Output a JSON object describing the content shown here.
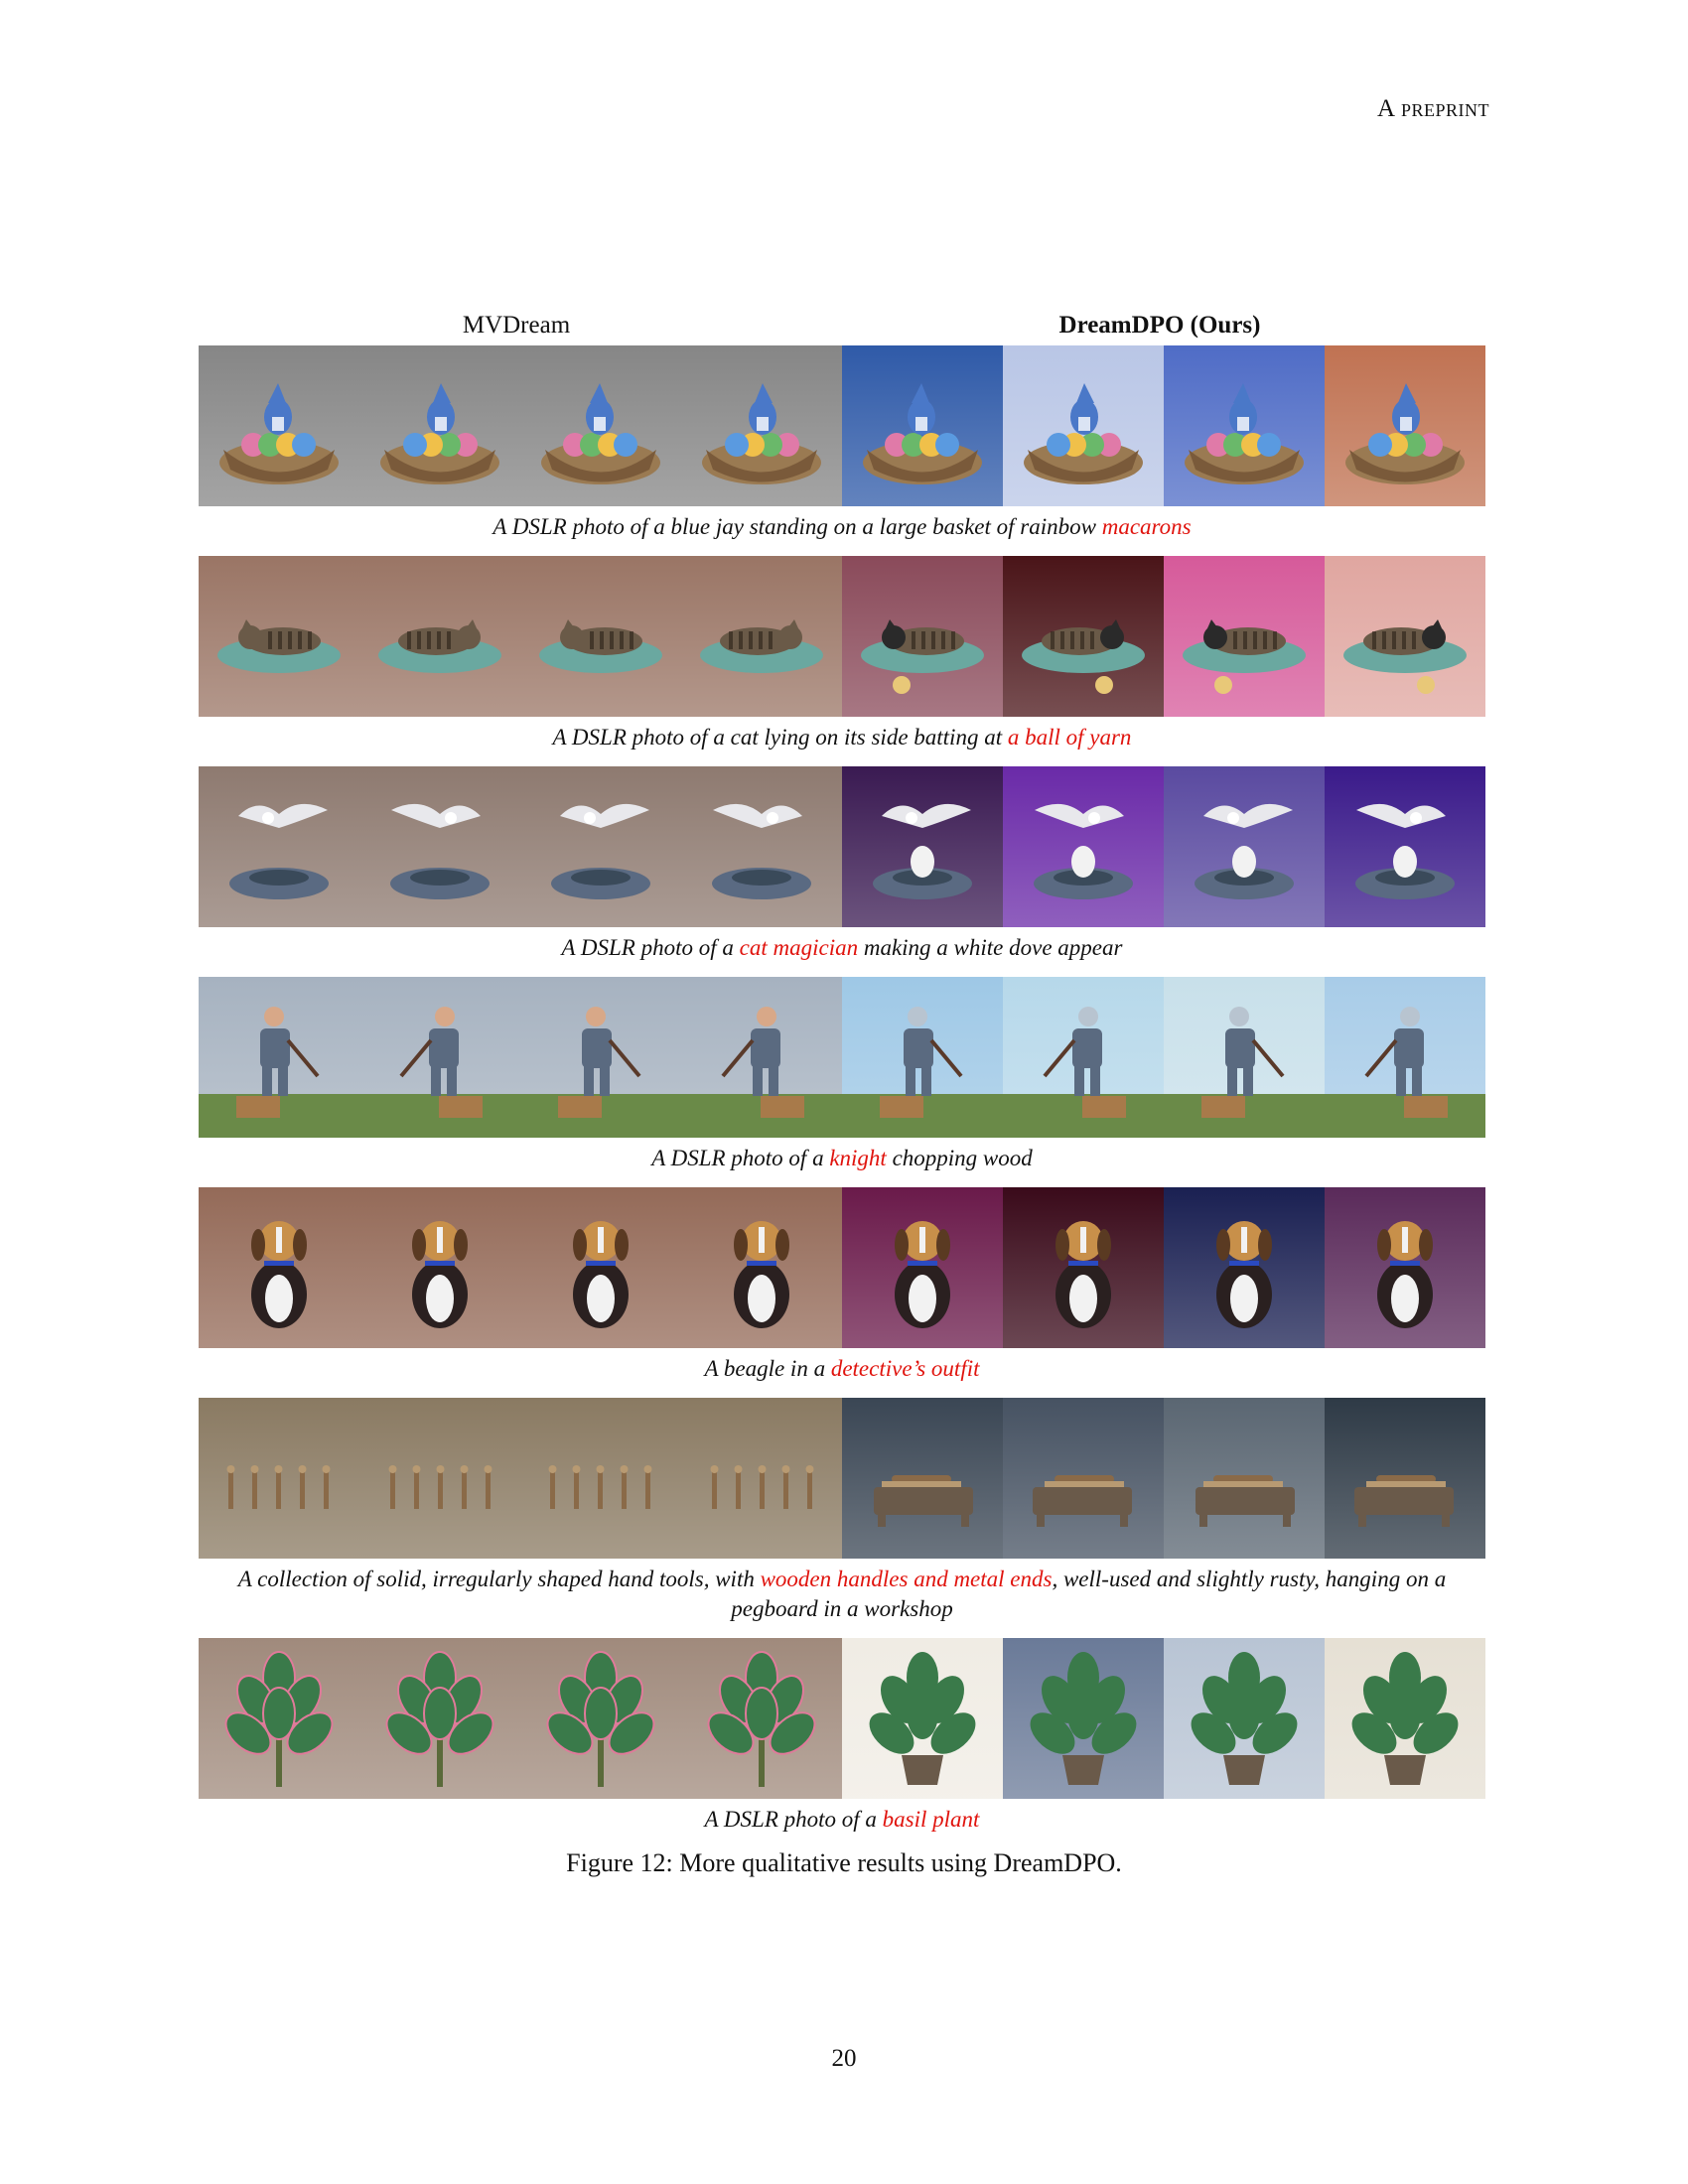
{
  "running_head": "A preprint",
  "columns": {
    "left": "MVDream",
    "right": "DreamDPO (Ours)"
  },
  "rows": [
    {
      "subject": "blue jay on macaron basket",
      "caption": {
        "pre": "A DSLR photo of a blue jay standing on a large basket of rainbow ",
        "hl": "macarons",
        "post": ""
      },
      "left_bg": "#868686",
      "right_bgs": [
        "#2f5aa8",
        "#b9c6e6",
        "#4f6cc6",
        "#c07252"
      ],
      "colors": {
        "main": "#4a78c8",
        "base": "#9a7a52",
        "accent": "#e07aa8"
      }
    },
    {
      "subject": "cat on yarn mat",
      "caption": {
        "pre": "A DSLR photo of a cat lying on its side batting at ",
        "hl": "a ball of yarn",
        "post": ""
      },
      "left_bg": "#9a7565",
      "right_bgs": [
        "#8a4a5a",
        "#4a1418",
        "#d65a9a",
        "#e0a6a0"
      ],
      "colors": {
        "main": "#6a5a48",
        "base": "#6aa8a0",
        "accent": "#e8c878"
      }
    },
    {
      "subject": "dove and cat magician",
      "caption": {
        "pre": "A DSLR photo of a ",
        "hl": "cat magician",
        "post": " making a white dove appear"
      },
      "left_bg": "#8e7a70",
      "right_bgs": [
        "#3a1a52",
        "#6a2aa8",
        "#5a4aa0",
        "#3a1a8a"
      ],
      "colors": {
        "main": "#e8e8ec",
        "base": "#5a6a82",
        "accent": "#c8a048"
      }
    },
    {
      "subject": "person chopping wood",
      "caption": {
        "pre": "A DSLR photo of a ",
        "hl": "knight",
        "post": " chopping wood"
      },
      "left_bg": "#a6b2c0",
      "right_bgs": [
        "#9ec8e6",
        "#b6d8ea",
        "#c8e0ea",
        "#a8cce8"
      ],
      "colors": {
        "main": "#5a6a80",
        "base": "#6a8a48",
        "accent": "#a87a4a"
      }
    },
    {
      "subject": "beagle",
      "caption": {
        "pre": "A beagle in a ",
        "hl": "detective’s outfit",
        "post": ""
      },
      "left_bg": "#946a58",
      "right_bgs": [
        "#6a1a4a",
        "#3a0a1a",
        "#1a2052",
        "#5a2a5a"
      ],
      "colors": {
        "main": "#c8904a",
        "base": "#f2f2f2",
        "accent": "#2a2020"
      }
    },
    {
      "subject": "hand tools",
      "caption": {
        "pre": "A collection of solid, irregularly shaped hand tools, with ",
        "hl": "wooden handles and metal ends",
        "post": ", well-used and slightly rusty, hanging on a pegboard in a workshop"
      },
      "left_bg": "#8a7a62",
      "right_bgs": [
        "#3a4654",
        "#465262",
        "#5a6672",
        "#2e3a46"
      ],
      "colors": {
        "main": "#8a6a48",
        "base": "#6a5a4a",
        "accent": "#b89a72"
      }
    },
    {
      "subject": "plant",
      "caption": {
        "pre": "A DSLR photo of a ",
        "hl": "basil plant",
        "post": ""
      },
      "left_bg": "#a08a7c",
      "right_bgs": [
        "#f0ece4",
        "#6a7a98",
        "#b8c4d4",
        "#e6e0d4"
      ],
      "colors": {
        "main": "#3a7a4a",
        "base": "#6a5a4a",
        "accent": "#e07a9a"
      }
    }
  ],
  "figure_caption": "Figure 12: More qualitative results using DreamDPO.",
  "page_number": "20"
}
